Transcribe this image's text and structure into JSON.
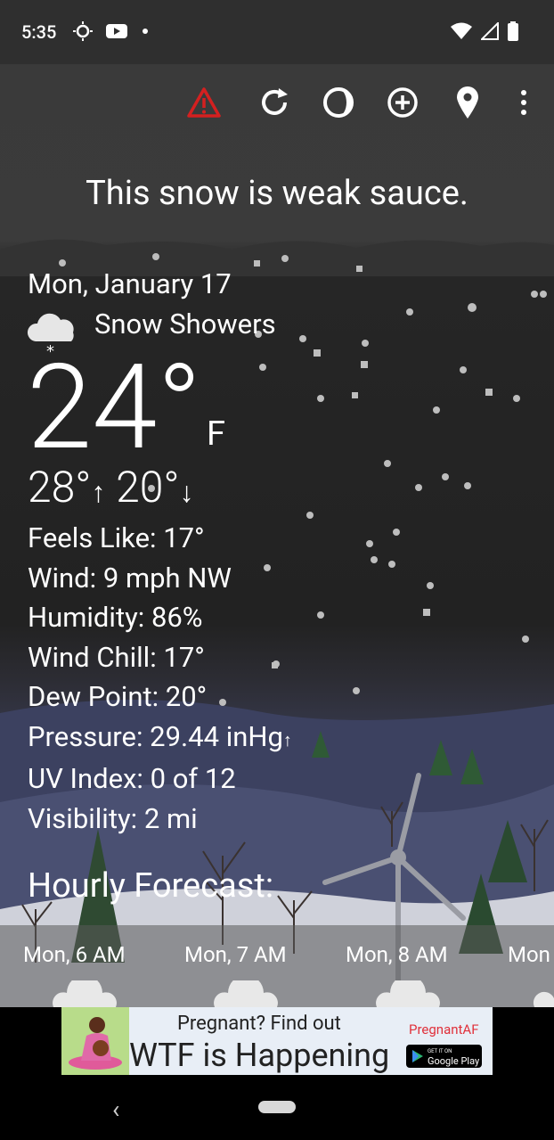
{
  "status_bar": {
    "time": "5:35"
  },
  "toolbar": {
    "icons": [
      "alert-icon",
      "refresh-icon",
      "theme-icon",
      "add-location-icon",
      "location-pin-icon",
      "more-icon"
    ]
  },
  "quote": "This snow is weak sauce.",
  "current": {
    "date": "Mon, January 17",
    "condition": "Snow Showers",
    "temperature": "24°",
    "unit": "F",
    "high": "28°",
    "low": "20°",
    "details": [
      "Feels Like:  17°",
      "Wind:  9 mph NW",
      "Humidity:  86%",
      "Wind Chill:  17°",
      "Dew Point:  20°",
      "Pressure:  29.44 inHg",
      "UV Index:  0 of 12",
      "Visibility:  2 mi"
    ]
  },
  "hourly": {
    "title": "Hourly Forecast:",
    "hours": [
      "Mon, 6 AM",
      "Mon, 7 AM",
      "Mon, 8 AM",
      "Mon"
    ]
  },
  "ad": {
    "line1": "Pregnant? Find out",
    "line2": "WTF is Happening",
    "brand": "PregnantAF",
    "store": "Google Play",
    "store_prefix": "GET IT ON"
  },
  "colors": {
    "alert": "#d42020",
    "ad_brand": "#e0303a"
  }
}
